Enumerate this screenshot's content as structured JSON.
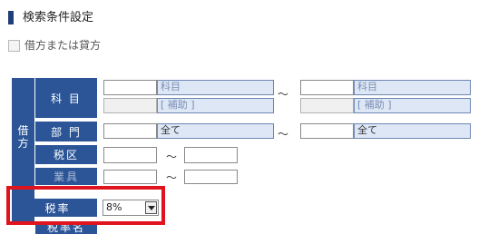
{
  "header": {
    "title": "検索条件設定"
  },
  "option": {
    "label": "借方または貸方"
  },
  "side_label": [
    "借",
    "方"
  ],
  "rows": {
    "subject": {
      "label": "科 目",
      "from_name": "科目",
      "from_sub": "[ 補助 ]",
      "to_name": "科目",
      "to_sub": "[ 補助 ]",
      "tilde": "～"
    },
    "dept": {
      "label": "部 門",
      "from_name": "全て",
      "to_name": "全て",
      "tilde": "～"
    },
    "tax_type": {
      "label": "税区",
      "tilde": "～"
    },
    "business": {
      "label": "業具",
      "tilde": "～"
    },
    "tax_rate": {
      "label": "税率",
      "value": "8%"
    },
    "next": {
      "label": "税率名"
    }
  },
  "colors": {
    "accent": "#2b5597",
    "highlight": "#e0141e",
    "field_blue": "#dde7f5"
  },
  "icons": {
    "dropdown": "chevron-down-icon"
  }
}
